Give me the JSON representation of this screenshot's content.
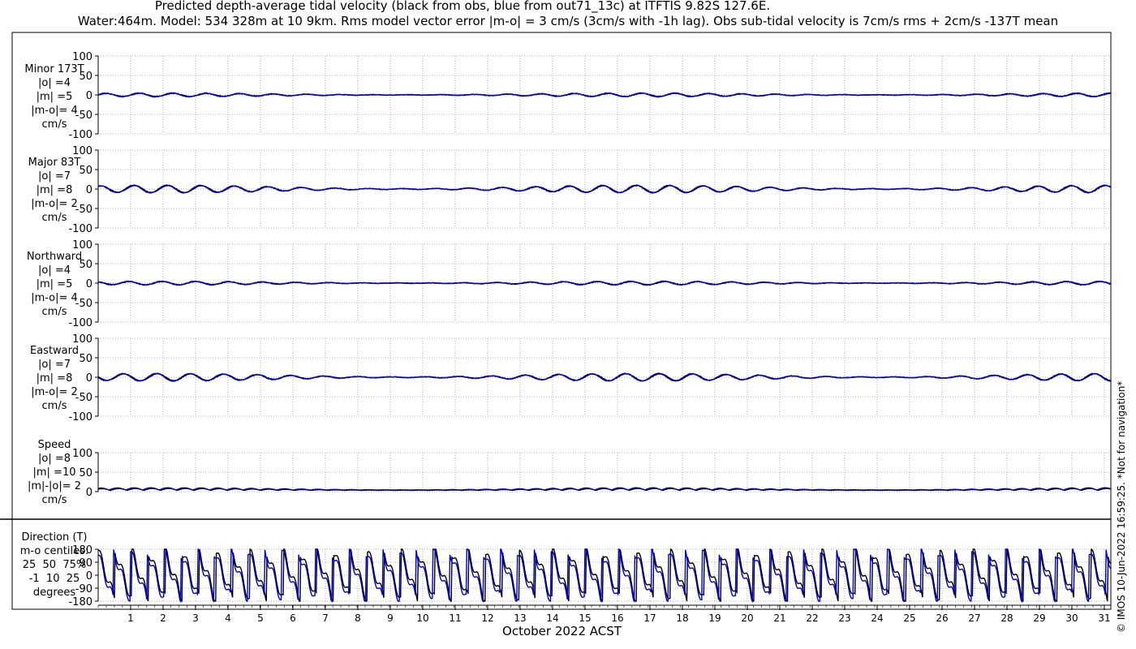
{
  "title_line1": "Predicted depth-average tidal velocity (black from obs, blue from out71_13c) at ITFTIS 9.82S 127.6E.",
  "title_line2": "Water:464m. Model: 534 328m at 10 9km. Rms model vector error |m-o| = 3 cm/s (3cm/s with -1h lag). Obs sub-tidal velocity is 7cm/s rms + 2cm/s -137T mean",
  "credit": "© IMOS 10-Jun-2022 16:59:25. *Not for navigation*",
  "xaxis_title": "October 2022 ACST",
  "colors": {
    "obs": "#000000",
    "model": "#0000cc",
    "grid": "#999999"
  },
  "panels": [
    {
      "key": "minor",
      "label_lines": [
        "Minor 173T",
        "|o| =4",
        "|m| =5",
        "|m-o|= 4",
        "cm/s"
      ]
    },
    {
      "key": "major",
      "label_lines": [
        "Major 83T",
        "|o| =7",
        "|m| =8",
        "|m-o|= 2",
        "cm/s"
      ]
    },
    {
      "key": "north",
      "label_lines": [
        "Northward",
        "|o| =4",
        "|m| =5",
        "|m-o|= 4",
        "cm/s"
      ]
    },
    {
      "key": "east",
      "label_lines": [
        "Eastward",
        "|o| =7",
        "|m| =8",
        "|m-o|= 2",
        "cm/s"
      ]
    },
    {
      "key": "speed",
      "label_lines": [
        "Speed",
        "|o| =8",
        "|m| =10",
        "|m|-|o|= 2",
        "cm/s"
      ]
    },
    {
      "key": "direction",
      "label_lines": [
        "Direction (T)",
        "m-o centiles:",
        "25  50  75%",
        "-1  10  25",
        "degrees"
      ]
    }
  ],
  "chart_data": [
    {
      "type": "line",
      "name": "minor",
      "ylim": [
        -100,
        100
      ],
      "yticks": [
        "100",
        "50",
        "0",
        "-50",
        "-100"
      ],
      "x_range_days": [
        0,
        31.3
      ],
      "tidal_amplitude_obs": 4,
      "tidal_amplitude_model": 5
    },
    {
      "type": "line",
      "name": "major",
      "ylim": [
        -100,
        100
      ],
      "yticks": [
        "100",
        "50",
        "0",
        "-50",
        "-100"
      ],
      "x_range_days": [
        0,
        31.3
      ],
      "tidal_amplitude_obs": 9,
      "tidal_amplitude_model": 10
    },
    {
      "type": "line",
      "name": "northward",
      "ylim": [
        -100,
        100
      ],
      "yticks": [
        "100",
        "50",
        "0",
        "-50",
        "-100"
      ],
      "x_range_days": [
        0,
        31.3
      ],
      "tidal_amplitude_obs": 4,
      "tidal_amplitude_model": 5
    },
    {
      "type": "line",
      "name": "eastward",
      "ylim": [
        -100,
        100
      ],
      "yticks": [
        "100",
        "50",
        "0",
        "-50",
        "-100"
      ],
      "x_range_days": [
        0,
        31.3
      ],
      "tidal_amplitude_obs": 9,
      "tidal_amplitude_model": 10
    },
    {
      "type": "line",
      "name": "speed",
      "ylim": [
        0,
        100
      ],
      "yticks": [
        "100",
        "50",
        "0"
      ],
      "x_range_days": [
        0,
        31.3
      ],
      "mean_obs": 8,
      "mean_model": 10
    },
    {
      "type": "line",
      "name": "direction",
      "ylim": [
        -180,
        180
      ],
      "yticks": [
        "180",
        "90",
        "0",
        "-90",
        "-180"
      ],
      "x_range_days": [
        0,
        31.3
      ]
    }
  ],
  "xtick_labels": [
    "1",
    "2",
    "3",
    "4",
    "5",
    "6",
    "7",
    "8",
    "9",
    "10",
    "11",
    "12",
    "13",
    "14",
    "15",
    "16",
    "17",
    "18",
    "19",
    "20",
    "21",
    "22",
    "23",
    "24",
    "25",
    "26",
    "27",
    "28",
    "29",
    "30",
    "31"
  ]
}
